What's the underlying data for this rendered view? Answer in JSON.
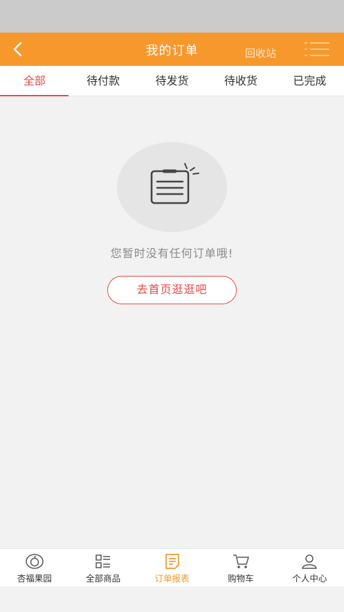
{
  "header": {
    "title": "我的订单",
    "recycle_label": "回收站",
    "bg_color": "#f7982d"
  },
  "tabs": [
    {
      "label": "全部",
      "active": true
    },
    {
      "label": "待付款",
      "active": false
    },
    {
      "label": "待发货",
      "active": false
    },
    {
      "label": "待收货",
      "active": false
    },
    {
      "label": "已完成",
      "active": false
    }
  ],
  "empty_state": {
    "icon": "order-clipboard-icon",
    "message": "您暂时没有任何订单哦!",
    "button_label": "去首页逛逛吧"
  },
  "bottom_nav": [
    {
      "label": "杏福果园",
      "icon": "orchard-icon",
      "active": false
    },
    {
      "label": "全部商品",
      "icon": "grid-list-icon",
      "active": false
    },
    {
      "label": "订单报表",
      "icon": "order-report-icon",
      "active": true
    },
    {
      "label": "购物车",
      "icon": "cart-icon",
      "active": false
    },
    {
      "label": "个人中心",
      "icon": "user-icon",
      "active": false
    }
  ],
  "colors": {
    "accent": "#e8494b",
    "nav_active": "#f0962a"
  }
}
